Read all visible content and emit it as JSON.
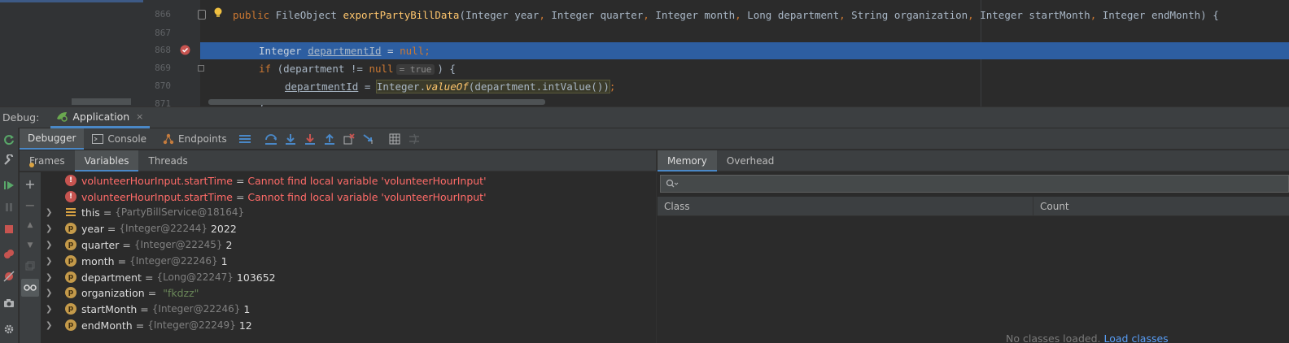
{
  "editor": {
    "lines": [
      {
        "num": "866",
        "tokens": {
          "kw1": "public",
          "t1": " FileObject ",
          "fn": "exportPartyBillData",
          "t2": "(Integer year",
          "c1": ",",
          "t3": " Integer quarter",
          "c2": ",",
          "t4": " Integer month",
          "c3": ",",
          "t5": " Long department",
          "c4": ",",
          "t6": " String organization",
          "c5": ",",
          "t7": " Integer startMonth",
          "c6": ",",
          "t8": " Integer endMonth) {"
        }
      },
      {
        "num": "867"
      },
      {
        "num": "868",
        "tokens": {
          "t1": "Integer ",
          "var": "departmentId",
          "t2": " = ",
          "kw": "null",
          "t3": ";"
        }
      },
      {
        "num": "869",
        "tokens": {
          "kw1": "if",
          "t1": " (department != ",
          "kw2": "null",
          "hint": "= true",
          "t2": ") {"
        }
      },
      {
        "num": "870",
        "tokens": {
          "var": "departmentId",
          "t1": " = ",
          "cls": "Integer.",
          "m": "valueOf",
          "t2": "(department.intValue())",
          "t3": ";"
        }
      },
      {
        "num": "871",
        "tokens": {
          "t1": "}"
        }
      }
    ]
  },
  "debug": {
    "label": "Debug:",
    "tab": "Application",
    "close": "×"
  },
  "toolbar": {
    "tabs": [
      "Debugger",
      "Console",
      "Endpoints"
    ]
  },
  "variables": {
    "subtabs": [
      "Frames",
      "Variables",
      "Threads"
    ],
    "rows": [
      {
        "kind": "err",
        "name": "volunteerHourInput.startTime",
        "eq": "=",
        "msg": "Cannot find local variable 'volunteerHourInput'"
      },
      {
        "kind": "err",
        "name": "volunteerHourInput.startTime",
        "eq": "=",
        "msg": "Cannot find local variable 'volunteerHourInput'"
      },
      {
        "kind": "obj",
        "name": "this",
        "eq": "=",
        "type": "{PartyBillService@18164}",
        "value": ""
      },
      {
        "kind": "p",
        "name": "year",
        "eq": "=",
        "type": "{Integer@22244}",
        "value": "2022"
      },
      {
        "kind": "p",
        "name": "quarter",
        "eq": "=",
        "type": "{Integer@22245}",
        "value": "2"
      },
      {
        "kind": "p",
        "name": "month",
        "eq": "=",
        "type": "{Integer@22246}",
        "value": "1"
      },
      {
        "kind": "p",
        "name": "department",
        "eq": "=",
        "type": "{Long@22247}",
        "value": "103652"
      },
      {
        "kind": "p",
        "name": "organization",
        "eq": "=",
        "type": "",
        "value": "\"fkdzz\""
      },
      {
        "kind": "p",
        "name": "startMonth",
        "eq": "=",
        "type": "{Integer@22246}",
        "value": "1"
      },
      {
        "kind": "p",
        "name": "endMonth",
        "eq": "=",
        "type": "{Integer@22249}",
        "value": "12"
      }
    ]
  },
  "memory": {
    "tabs": [
      "Memory",
      "Overhead"
    ],
    "columns": [
      "Class",
      "Count"
    ],
    "empty_text": "No classes loaded.",
    "empty_link": "Load classes"
  }
}
